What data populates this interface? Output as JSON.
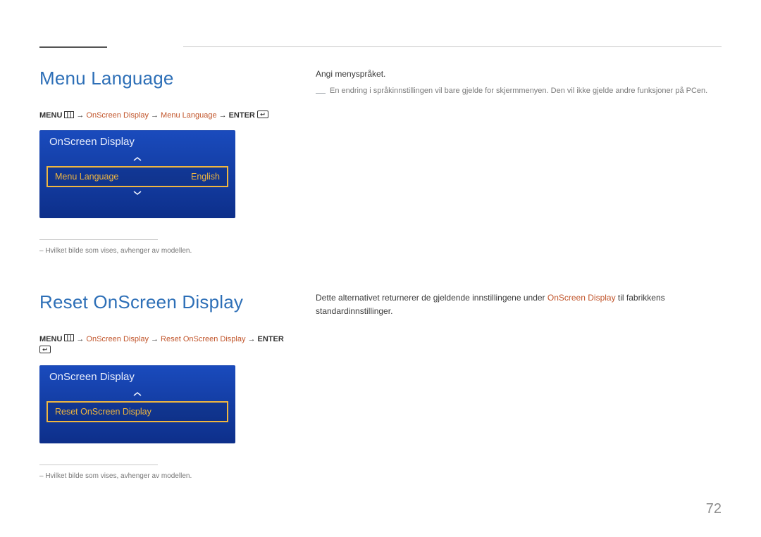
{
  "page_number": "72",
  "section1": {
    "heading": "Menu Language",
    "breadcrumb": {
      "menu": "MENU",
      "item1": "OnScreen Display",
      "item2": "Menu Language",
      "enter": "ENTER"
    },
    "osd": {
      "title": "OnScreen Display",
      "row_label": "Menu Language",
      "row_value": "English"
    },
    "footnote": "–  Hvilket bilde som vises, avhenger av modellen.",
    "right": {
      "line1": "Angi menyspråket.",
      "note": "En endring i språkinnstillingen vil bare gjelde for skjermmenyen. Den vil ikke gjelde andre funksjoner på PCen."
    }
  },
  "section2": {
    "heading": "Reset OnScreen Display",
    "breadcrumb": {
      "menu": "MENU",
      "item1": "OnScreen Display",
      "item2": "Reset OnScreen Display",
      "enter": "ENTER"
    },
    "osd": {
      "title": "OnScreen Display",
      "row_label": "Reset OnScreen Display"
    },
    "footnote": "–  Hvilket bilde som vises, avhenger av modellen.",
    "right": {
      "prefix": "Dette alternativet returnerer de gjeldende innstillingene under ",
      "link": "OnScreen Display",
      "suffix": " til fabrikkens standardinnstillinger."
    }
  }
}
